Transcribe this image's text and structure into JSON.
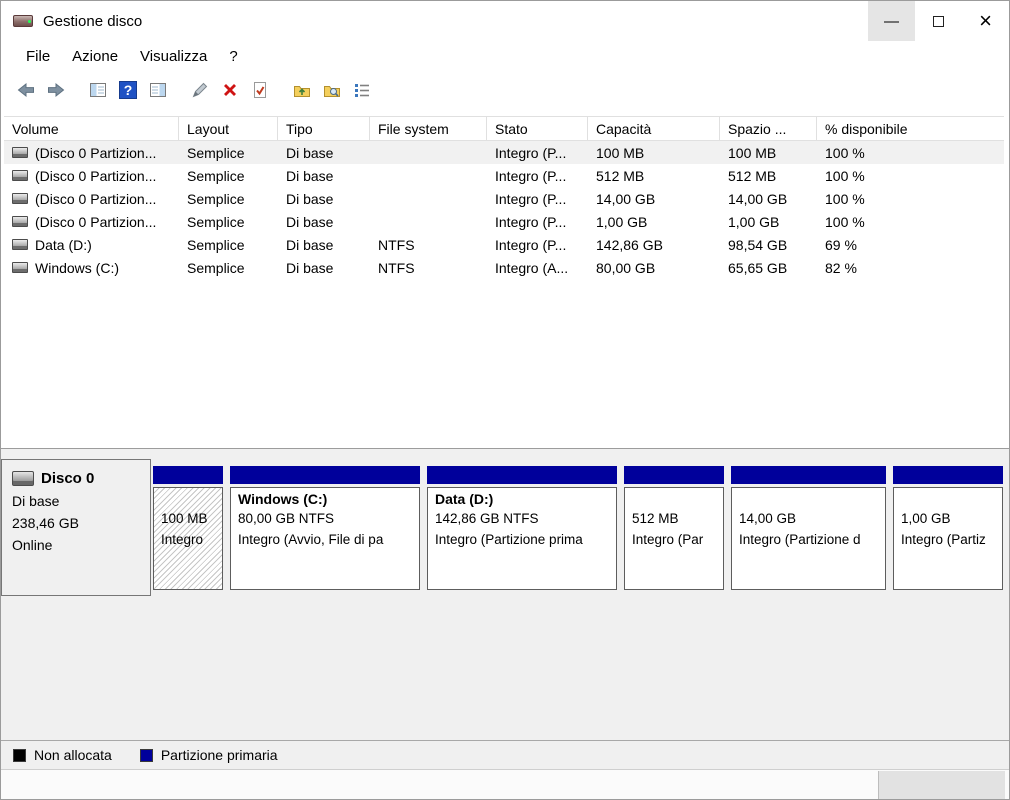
{
  "window": {
    "title": "Gestione disco",
    "controls": {
      "minimize": "—",
      "close": "×"
    }
  },
  "menu": {
    "items": [
      "File",
      "Azione",
      "Visualizza",
      "?"
    ]
  },
  "toolbar": {
    "icons": [
      "back-arrow",
      "forward-arrow",
      "show-console-tree",
      "help",
      "show-action-pane",
      "pen",
      "delete",
      "properties",
      "move-up-folder",
      "search-folder",
      "list-view"
    ]
  },
  "table": {
    "columns": [
      "Volume",
      "Layout",
      "Tipo",
      "File system",
      "Stato",
      "Capacità",
      "Spazio ...",
      "% disponibile"
    ],
    "rows": [
      [
        "(Disco 0 Partizion...",
        "Semplice",
        "Di base",
        "",
        "Integro (P...",
        "100 MB",
        "100 MB",
        "100 %"
      ],
      [
        "(Disco 0 Partizion...",
        "Semplice",
        "Di base",
        "",
        "Integro (P...",
        "512 MB",
        "512 MB",
        "100 %"
      ],
      [
        "(Disco 0 Partizion...",
        "Semplice",
        "Di base",
        "",
        "Integro (P...",
        "14,00 GB",
        "14,00 GB",
        "100 %"
      ],
      [
        "(Disco 0 Partizion...",
        "Semplice",
        "Di base",
        "",
        "Integro (P...",
        "1,00 GB",
        "1,00 GB",
        "100 %"
      ],
      [
        "Data (D:)",
        "Semplice",
        "Di base",
        "NTFS",
        "Integro (P...",
        "142,86 GB",
        "98,54 GB",
        "69 %"
      ],
      [
        "Windows (C:)",
        "Semplice",
        "Di base",
        "NTFS",
        "Integro (A...",
        "80,00 GB",
        "65,65 GB",
        "82 %"
      ]
    ]
  },
  "disk": {
    "name": "Disco 0",
    "type": "Di base",
    "size": "238,46 GB",
    "status": "Online",
    "partitions": [
      {
        "name": "",
        "size": "100 MB",
        "status": "Integro"
      },
      {
        "name": "Windows (C:)",
        "size": "80,00 GB NTFS",
        "status": "Integro (Avvio, File di pa"
      },
      {
        "name": "Data (D:)",
        "size": "142,86 GB NTFS",
        "status": "Integro (Partizione prima"
      },
      {
        "name": "",
        "size": "512 MB",
        "status": "Integro (Par"
      },
      {
        "name": "",
        "size": "14,00 GB",
        "status": "Integro (Partizione d"
      },
      {
        "name": "",
        "size": "1,00 GB",
        "status": "Integro (Partiz"
      }
    ]
  },
  "legend": {
    "items": [
      {
        "label": "Non allocata",
        "color": "#000000"
      },
      {
        "label": "Partizione primaria",
        "color": "#00009b"
      }
    ]
  },
  "colors": {
    "primary_partition": "#00009b"
  }
}
